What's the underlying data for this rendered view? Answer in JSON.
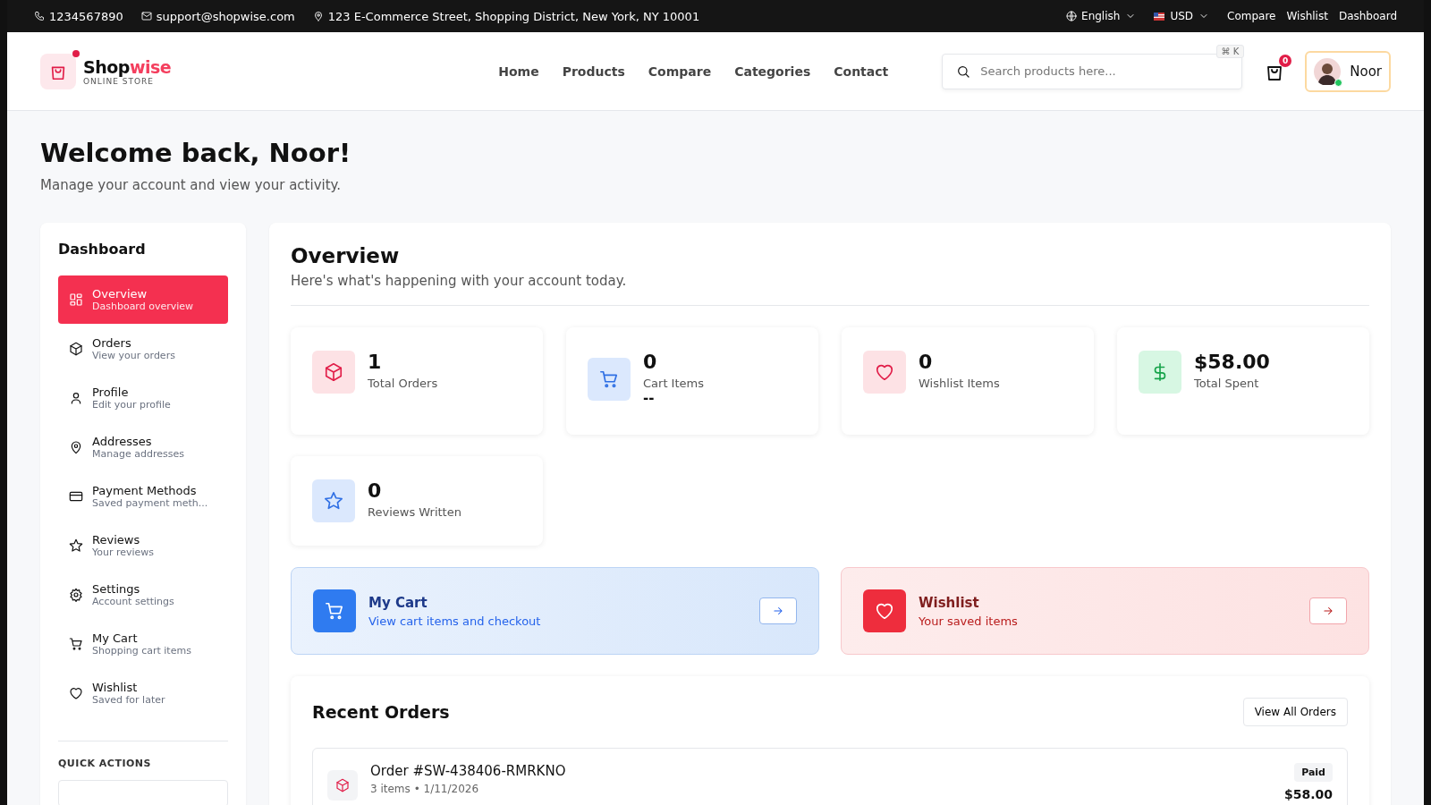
{
  "top_bar": {
    "phone": "1234567890",
    "email": "support@shopwise.com",
    "address": "123 E-Commerce Street, Shopping District, New York, NY 10001",
    "language": "English",
    "currency": "USD",
    "links": [
      "Compare",
      "Wishlist",
      "Dashboard"
    ]
  },
  "header": {
    "logo": {
      "name": "Shop",
      "name_accent": "wise",
      "tagline": "ONLINE STORE"
    },
    "nav": [
      "Home",
      "Products",
      "Compare",
      "Categories",
      "Contact"
    ],
    "search": {
      "placeholder": "Search products here...",
      "shortcut": "⌘ K"
    },
    "cart_count": "0",
    "user": {
      "name": "Noor",
      "online": true
    }
  },
  "page": {
    "title": "Welcome back, Noor!",
    "subtitle": "Manage your account and view your activity."
  },
  "sidebar": {
    "title": "Dashboard",
    "items": [
      {
        "kind": "overview",
        "label": "Overview",
        "sub": "Dashboard overview",
        "selected": true
      },
      {
        "kind": "orders",
        "label": "Orders",
        "sub": "View your orders",
        "selected": false
      },
      {
        "kind": "profile",
        "label": "Profile",
        "sub": "Edit your profile",
        "selected": false
      },
      {
        "kind": "addresses",
        "label": "Addresses",
        "sub": "Manage addresses",
        "selected": false
      },
      {
        "kind": "payment",
        "label": "Payment Methods",
        "sub": "Saved payment meth...",
        "selected": false
      },
      {
        "kind": "reviews",
        "label": "Reviews",
        "sub": "Your reviews",
        "selected": false
      },
      {
        "kind": "settings",
        "label": "Settings",
        "sub": "Account settings",
        "selected": false
      },
      {
        "kind": "cart",
        "label": "My Cart",
        "sub": "Shopping cart items",
        "selected": false
      },
      {
        "kind": "wishlist",
        "label": "Wishlist",
        "sub": "Saved for later",
        "selected": false
      }
    ],
    "quick_actions_title": "QUICK ACTIONS"
  },
  "overview": {
    "title": "Overview",
    "subtitle": "Here's what's happening with your account today.",
    "stats": [
      {
        "kind": "orders",
        "value": "1",
        "label": "Total Orders"
      },
      {
        "kind": "cart",
        "value": "0",
        "label": "Cart Items",
        "note": "--"
      },
      {
        "kind": "wishlist",
        "value": "0",
        "label": "Wishlist Items"
      },
      {
        "kind": "spent",
        "value": "$58.00",
        "label": "Total Spent"
      },
      {
        "kind": "reviews",
        "value": "0",
        "label": "Reviews Written"
      }
    ],
    "quick_links": [
      {
        "kind": "cart",
        "title": "My Cart",
        "sub": "View cart items and checkout"
      },
      {
        "kind": "wishlist",
        "title": "Wishlist",
        "sub": "Your saved items"
      }
    ],
    "recent_orders": {
      "title": "Recent Orders",
      "button": "View All Orders",
      "orders": [
        {
          "number": "Order #SW-438406-RMRKNO",
          "meta": "3 items • 1/11/2026",
          "status": "Paid",
          "total": "$58.00"
        }
      ]
    }
  }
}
